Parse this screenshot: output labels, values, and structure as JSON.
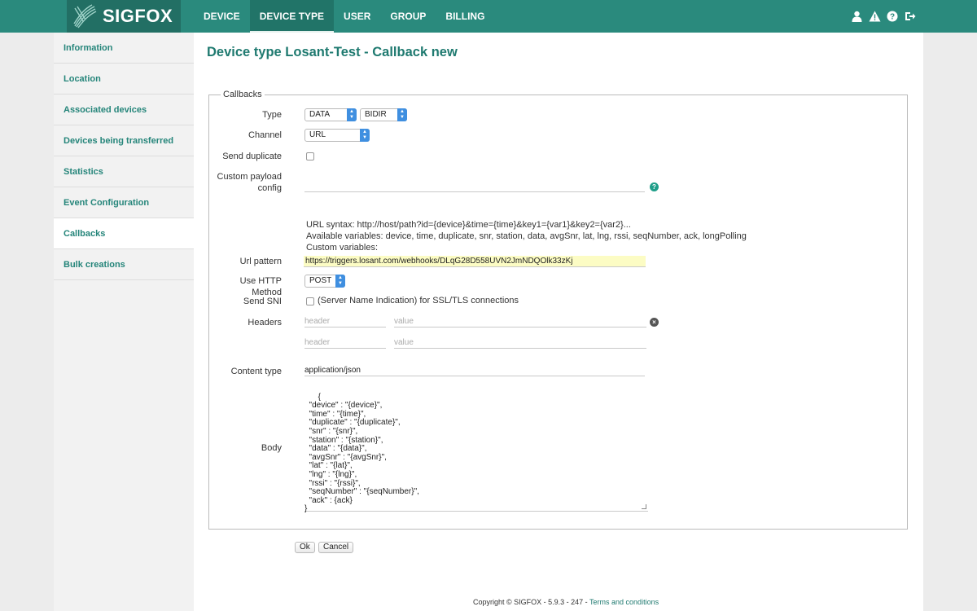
{
  "brand": {
    "name": "SIGFOX"
  },
  "nav": [
    {
      "label": "DEVICE",
      "active": false
    },
    {
      "label": "DEVICE TYPE",
      "active": true
    },
    {
      "label": "USER",
      "active": false
    },
    {
      "label": "GROUP",
      "active": false
    },
    {
      "label": "BILLING",
      "active": false
    }
  ],
  "top_icons": [
    "user-icon",
    "warning-icon",
    "help-icon",
    "logout-icon"
  ],
  "sidebar": {
    "items": [
      {
        "label": "Information"
      },
      {
        "label": "Location"
      },
      {
        "label": "Associated devices"
      },
      {
        "label": "Devices being transferred"
      },
      {
        "label": "Statistics"
      },
      {
        "label": "Event Configuration"
      },
      {
        "label": "Callbacks",
        "active": true
      },
      {
        "label": "Bulk creations"
      }
    ]
  },
  "page": {
    "title": "Device type Losant-Test - Callback new"
  },
  "form": {
    "legend": "Callbacks",
    "type_label": "Type",
    "type_value": "DATA",
    "direction_value": "BIDIR",
    "channel_label": "Channel",
    "channel_value": "URL",
    "send_duplicate_label": "Send duplicate",
    "custom_payload_label_1": "Custom payload",
    "custom_payload_label_2": "config",
    "url_syntax": "URL syntax: http://host/path?id={device}&time={time}&key1={var1}&key2={var2}...",
    "available_vars": "Available variables: device, time, duplicate, snr, station, data, avgSnr, lat, lng, rssi, seqNumber, ack, longPolling",
    "custom_vars": "Custom variables:",
    "url_pattern_label": "Url pattern",
    "url_pattern_value": "https://triggers.losant.com/webhooks/DLqG28D558UVN2JmNDQOlk33zKj",
    "http_method_label": "Use HTTP Method",
    "http_method_value": "POST",
    "send_sni_label": "Send SNI",
    "send_sni_text": "(Server Name Indication) for SSL/TLS connections",
    "headers_label": "Headers",
    "header_placeholder": "header",
    "value_placeholder": "value",
    "content_type_label": "Content type",
    "content_type_value": "application/json",
    "body_label": "Body",
    "body_value": "{\n  \"device\" : \"{device}\",\n  \"time\" : \"{time}\",\n  \"duplicate\" : \"{duplicate}\",\n  \"snr\" : \"{snr}\",\n  \"station\" : \"{station}\",\n  \"data\" : \"{data}\",\n  \"avgSnr\" : \"{avgSnr}\",\n  \"lat\" : \"{lat}\",\n  \"lng\" : \"{lng}\",\n  \"rssi\" : \"{rssi}\",\n  \"seqNumber\" : \"{seqNumber}\",\n  \"ack\" : {ack}\n}",
    "ok_label": "Ok",
    "cancel_label": "Cancel"
  },
  "footer": {
    "text": "Copyright © SIGFOX - 5.9.3 - 247 - ",
    "link": "Terms and conditions"
  },
  "colors": {
    "brand": "#2a8a7d",
    "link": "#1f7a70",
    "url_highlight": "#fcfcc4"
  }
}
